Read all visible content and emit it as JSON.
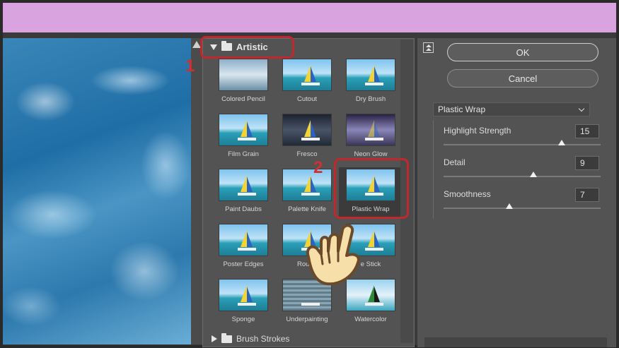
{
  "category": {
    "label": "Artistic"
  },
  "filters": [
    {
      "label": "Colored Pencil",
      "style": "cp"
    },
    {
      "label": "Cutout",
      "style": ""
    },
    {
      "label": "Dry Brush",
      "style": ""
    },
    {
      "label": "Film Grain",
      "style": ""
    },
    {
      "label": "Fresco",
      "style": "dark"
    },
    {
      "label": "Neon Glow",
      "style": "neon"
    },
    {
      "label": "Paint Daubs",
      "style": ""
    },
    {
      "label": "Palette Knife",
      "style": ""
    },
    {
      "label": "Plastic Wrap",
      "style": "",
      "selected": true
    },
    {
      "label": "Poster Edges",
      "style": ""
    },
    {
      "label": "Rough",
      "style": ""
    },
    {
      "label": "e Stick",
      "style": ""
    },
    {
      "label": "Sponge",
      "style": ""
    },
    {
      "label": "Underpainting",
      "style": "under"
    },
    {
      "label": "Watercolor",
      "style": "water"
    }
  ],
  "next_category": {
    "label": "Brush Strokes"
  },
  "annotations": {
    "step1": "1",
    "step2": "2"
  },
  "buttons": {
    "ok": "OK",
    "cancel": "Cancel"
  },
  "filter_select": {
    "value": "Plastic Wrap"
  },
  "params": [
    {
      "label": "Highlight Strength",
      "value": "15",
      "level": 0.75
    },
    {
      "label": "Detail",
      "value": "9",
      "level": 0.57
    },
    {
      "label": "Smoothness",
      "value": "7",
      "level": 0.42
    }
  ],
  "colors": {
    "title_bar": "#d8a3de",
    "highlight": "#c0282c",
    "annotation_number": "#d42f2f"
  }
}
